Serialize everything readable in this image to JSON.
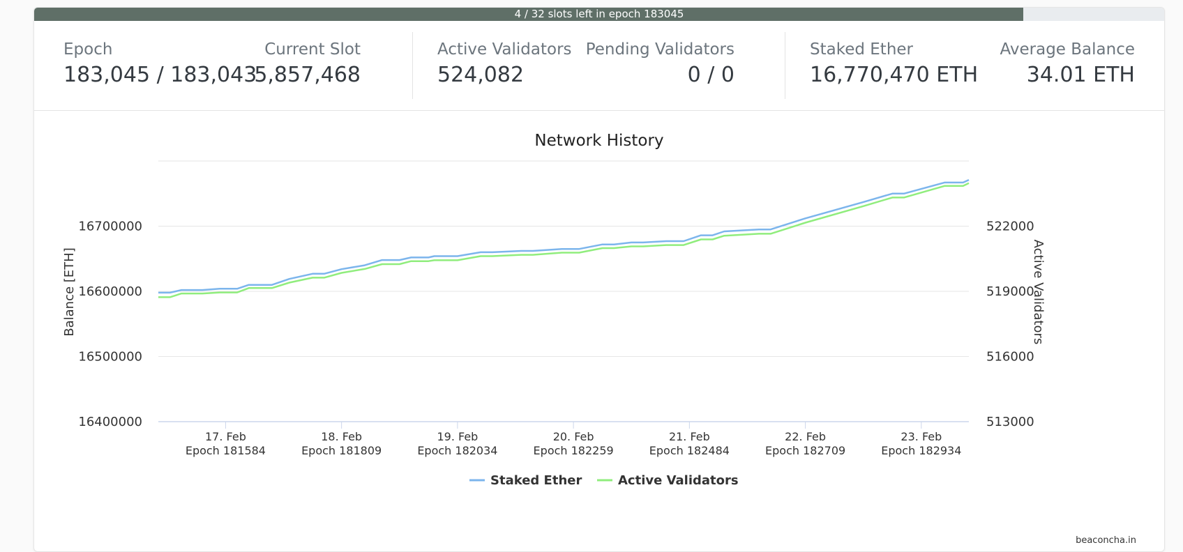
{
  "progress": {
    "text": "4 / 32 slots left in epoch 183045",
    "slots_left": 4,
    "slots_total": 32,
    "color": "#5f6f67"
  },
  "stats": {
    "epoch": {
      "label": "Epoch",
      "value": "183,045 / 183,043"
    },
    "current_slot": {
      "label": "Current Slot",
      "value": "5,857,468"
    },
    "active_validators": {
      "label": "Active Validators",
      "value": "524,082"
    },
    "pending_validators": {
      "label": "Pending Validators",
      "value": "0 / 0"
    },
    "staked_ether": {
      "label": "Staked Ether",
      "value": "16,770,470 ETH"
    },
    "average_balance": {
      "label": "Average Balance",
      "value": "34.01 ETH"
    }
  },
  "chart_data": {
    "type": "line",
    "title": "Network History",
    "ylabel": "Balance [ETH]",
    "y2label": "Active Validators",
    "ylim": [
      16400000,
      16800000
    ],
    "y2lim": [
      513000,
      525000
    ],
    "yticks": [
      "16400000",
      "16500000",
      "16600000",
      "16700000"
    ],
    "y2ticks": [
      "513000",
      "516000",
      "519000",
      "522000"
    ],
    "xrange": [
      16.42,
      23.41
    ],
    "xticks": [
      {
        "x": 17,
        "date": "17. Feb",
        "epoch": "Epoch 181584"
      },
      {
        "x": 18,
        "date": "18. Feb",
        "epoch": "Epoch 181809"
      },
      {
        "x": 19,
        "date": "19. Feb",
        "epoch": "Epoch 182034"
      },
      {
        "x": 20,
        "date": "20. Feb",
        "epoch": "Epoch 182259"
      },
      {
        "x": 21,
        "date": "21. Feb",
        "epoch": "Epoch 182484"
      },
      {
        "x": 22,
        "date": "22. Feb",
        "epoch": "Epoch 182709"
      },
      {
        "x": 23,
        "date": "23. Feb",
        "epoch": "Epoch 182934"
      }
    ],
    "grid": true,
    "legend_position": "bottom-center",
    "x": [
      16.42,
      16.52,
      16.62,
      16.8,
      16.95,
      17.1,
      17.2,
      17.4,
      17.55,
      17.75,
      17.85,
      18.0,
      18.2,
      18.35,
      18.5,
      18.6,
      18.75,
      18.8,
      19.0,
      19.2,
      19.3,
      19.55,
      19.65,
      19.9,
      20.05,
      20.25,
      20.35,
      20.5,
      20.6,
      20.8,
      20.85,
      20.95,
      21.1,
      21.2,
      21.3,
      21.6,
      21.7,
      22.0,
      22.5,
      22.75,
      22.85,
      23.2,
      23.36,
      23.41
    ],
    "series": [
      {
        "name": "Staked Ether",
        "color": "#7cb5ec",
        "values": [
          16598000,
          16598000,
          16602000,
          16602000,
          16604000,
          16604000,
          16610000,
          16610000,
          16619000,
          16627000,
          16627000,
          16634000,
          16640000,
          16648000,
          16648000,
          16652000,
          16652000,
          16654000,
          16654000,
          16660000,
          16660000,
          16662000,
          16662000,
          16665000,
          16665000,
          16672000,
          16672000,
          16675000,
          16675000,
          16677000,
          16677000,
          16677000,
          16686000,
          16686000,
          16692000,
          16695000,
          16695000,
          16712000,
          16737000,
          16750000,
          16750000,
          16767000,
          16767000,
          16771000
        ]
      },
      {
        "name": "Active Validators",
        "color": "#90ed7d",
        "values": [
          518730,
          518730,
          518900,
          518900,
          518950,
          518950,
          519150,
          519150,
          519400,
          519630,
          519630,
          519850,
          520030,
          520250,
          520250,
          520390,
          520390,
          520430,
          520430,
          520620,
          520620,
          520680,
          520680,
          520780,
          520780,
          520990,
          520990,
          521070,
          521070,
          521130,
          521130,
          521130,
          521390,
          521390,
          521560,
          521650,
          521650,
          522160,
          522920,
          523320,
          523320,
          523850,
          523850,
          523980
        ]
      }
    ]
  },
  "credits": "beaconcha.in"
}
